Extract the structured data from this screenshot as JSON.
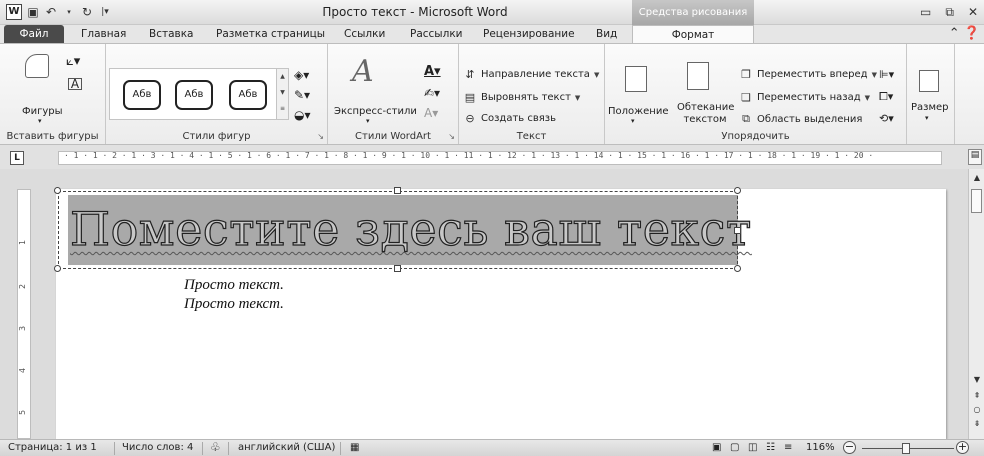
{
  "window": {
    "title": "Просто текст - Microsoft Word",
    "context_tab_title": "Средства рисования",
    "word_icon": "W",
    "qat_icons": [
      "save-icon",
      "undo-icon",
      "redo-icon",
      "customize-icon"
    ],
    "controls": {
      "minimize": "▭",
      "restore": "⧉",
      "close": "✕"
    }
  },
  "ribbon_tabs": {
    "file": "Файл",
    "home": "Главная",
    "insert": "Вставка",
    "layout": "Разметка страницы",
    "references": "Ссылки",
    "mailings": "Рассылки",
    "review": "Рецензирование",
    "view": "Вид",
    "format": "Формат"
  },
  "groups": {
    "insert_shapes": {
      "label": "Вставить фигуры",
      "shapes_button": "Фигуры"
    },
    "shape_styles": {
      "label": "Стили фигур",
      "style1": "Абв",
      "style2": "Абв",
      "style3": "Абв"
    },
    "wordart_styles": {
      "label": "Стили WordArt",
      "express_styles": "Экспресс-стили"
    },
    "text": {
      "label": "Текст",
      "text_direction": "Направление текста",
      "align_text": "Выровнять текст",
      "create_link": "Создать связь"
    },
    "arrange": {
      "label": "Упорядочить",
      "position": "Положение",
      "wrap_text": "Обтекание текстом",
      "bring_forward": "Переместить вперед",
      "send_backward": "Переместить назад",
      "selection_pane": "Область выделения"
    },
    "size": {
      "label": "Размер",
      "size_button": "Размер"
    }
  },
  "ruler": {
    "tab_selector": "L",
    "h_numbers": "· 1 · 1 · 2 · 1 · 3 · 1 · 4 · 1 · 5 · 1 · 6 · 1 · 7 · 1 · 8 · 1 · 9 · 1 · 10 · 1 · 11 · 1 · 12 · 1 · 13 · 1 · 14 · 1 · 15 · 1 · 16 · 1 · 17 · 1 · 18 · 1 · 19 · 1 · 20 ·",
    "v_numbers": [
      "1",
      "2",
      "3",
      "4",
      "5"
    ]
  },
  "document": {
    "wordart_text": "Поместите здесь ваш текст",
    "lines": [
      "Просто текст.",
      "Просто текст."
    ]
  },
  "statusbar": {
    "page": "Страница: 1 из 1",
    "words": "Число слов: 4",
    "language": "английский (США)",
    "zoom": "116%",
    "zoom_level_percent": 116
  }
}
